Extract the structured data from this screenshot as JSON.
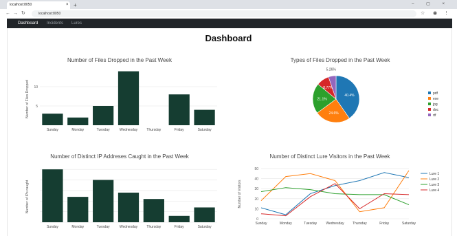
{
  "browser": {
    "tab_title": "localhost:8050",
    "tab_close": "×",
    "new_tab": "+",
    "window_controls": "–  ▢  ×",
    "back": "←",
    "forward": "→",
    "reload": "↻",
    "address": "localhost:8050",
    "star": "☆",
    "profile": "◉",
    "menu": "⋮"
  },
  "nav": {
    "items": [
      {
        "label": "Dashboard",
        "active": true
      },
      {
        "label": "Incidents",
        "active": false
      },
      {
        "label": "Lures",
        "active": false
      }
    ]
  },
  "page": {
    "title": "Dashboard"
  },
  "colors": {
    "bar": "#153d31",
    "pie": [
      "#1f77b4",
      "#ff7f0e",
      "#2ca02c",
      "#d62728",
      "#9467bd"
    ],
    "lines": [
      "#1f77b4",
      "#ff7f0e",
      "#2ca02c",
      "#d62728"
    ]
  },
  "chart_data": [
    {
      "type": "bar",
      "title": "Number of Files Dropped in the Past Week",
      "categories": [
        "Sunday",
        "Monday",
        "Tuesday",
        "Wednesday",
        "Thursday",
        "Friday",
        "Saturday"
      ],
      "values": [
        3,
        2,
        5,
        14,
        0,
        8,
        4
      ],
      "xlabel": "",
      "ylabel": "Number of Files Dropped",
      "ylim": [
        0,
        15
      ],
      "yticks": [
        5,
        10
      ],
      "ytick_labels": [
        "5",
        "10"
      ],
      "grid": true
    },
    {
      "type": "pie",
      "title": "Types of Files Dropped in the Past Week",
      "labels": [
        "pdf",
        "exe",
        "jpg",
        "doc",
        "rtf"
      ],
      "values": [
        40.4,
        24.6,
        21.1,
        8.77,
        5.26
      ],
      "slice_labels": [
        "40.4%",
        "24.6%",
        "21.1%",
        "8.77%",
        "5.26%"
      ],
      "legend": "right"
    },
    {
      "type": "bar",
      "title": "Number of Distinct IP Addreses Caught in the Past Week",
      "categories": [
        "Sunday",
        "Monday",
        "Tuesday",
        "Wednesday",
        "Thursday",
        "Friday",
        "Saturday"
      ],
      "values": [
        25,
        12,
        20,
        14,
        11,
        3,
        7
      ],
      "xlabel": "",
      "ylabel": "Number of IPs caught",
      "ylim": [
        0,
        27
      ],
      "yticks": [
        0,
        5,
        10,
        15,
        20,
        25
      ],
      "ytick_labels": [
        "",
        "",
        "",
        "",
        "",
        ""
      ],
      "grid": true
    },
    {
      "type": "line",
      "title": "Number of Distinct Lure Visitors in the Past Week",
      "x": [
        "Sunday",
        "Monday",
        "Tuesday",
        "Wednesday",
        "Thursday",
        "Friday",
        "Saturday"
      ],
      "series": [
        {
          "name": "Lure 1",
          "values": [
            11,
            4,
            25,
            33,
            38,
            46,
            41
          ]
        },
        {
          "name": "Lure 2",
          "values": [
            18,
            42,
            45,
            38,
            7,
            11,
            48
          ]
        },
        {
          "name": "Lure 3",
          "values": [
            27,
            31,
            29,
            25,
            24,
            24,
            14
          ]
        },
        {
          "name": "Lure 4",
          "values": [
            5,
            3,
            22,
            35,
            10,
            25,
            24
          ]
        }
      ],
      "xlabel": "",
      "ylabel": "Number of Visitors",
      "ylim": [
        0,
        52
      ],
      "yticks": [
        0,
        10,
        20,
        30,
        40,
        50
      ],
      "ytick_labels": [
        "0",
        "10",
        "20",
        "30",
        "40",
        "50"
      ],
      "legend": "right",
      "grid": true
    }
  ]
}
